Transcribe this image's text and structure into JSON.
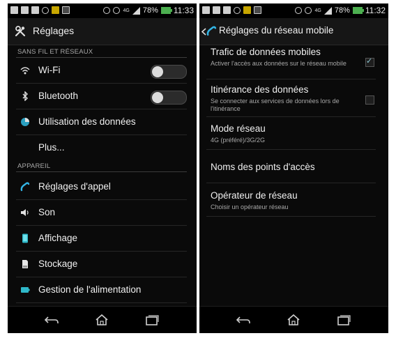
{
  "left": {
    "status": {
      "battery": "78%",
      "time": "11:33",
      "network": "4G"
    },
    "header": {
      "title": "Réglages"
    },
    "sections": {
      "wireless": "SANS FIL ET RÉSEAUX",
      "device": "APPAREIL"
    },
    "items": [
      {
        "label": "Wi-Fi",
        "icon": "wifi-icon",
        "toggle": "off"
      },
      {
        "label": "Bluetooth",
        "icon": "bluetooth-icon",
        "toggle": "off"
      },
      {
        "label": "Utilisation des données",
        "icon": "data-usage-icon"
      },
      {
        "label": "Plus..."
      },
      {
        "label": "Réglages d'appel",
        "icon": "phone-icon"
      },
      {
        "label": "Son",
        "icon": "speaker-icon"
      },
      {
        "label": "Affichage",
        "icon": "display-icon"
      },
      {
        "label": "Stockage",
        "icon": "storage-icon"
      },
      {
        "label": "Gestion de l'alimentation",
        "icon": "battery-icon"
      }
    ]
  },
  "right": {
    "status": {
      "battery": "78%",
      "time": "11:32",
      "network": "4G"
    },
    "header": {
      "title": "Réglages du réseau mobile"
    },
    "items": [
      {
        "title": "Trafic de données mobiles",
        "subtitle": "Activer l'accès aux données sur le réseau mobile",
        "checked": true
      },
      {
        "title": "Itinérance des données",
        "subtitle": "Se connecter aux services de données lors de l'itinérance",
        "checked": false
      },
      {
        "title": "Mode réseau",
        "subtitle": "4G (préféré)/3G/2G"
      },
      {
        "title": "Noms des points d'accès"
      },
      {
        "title": "Opérateur de réseau",
        "subtitle": "Choisir un opérateur réseau"
      }
    ]
  },
  "colors": {
    "background": "#0a0a0a",
    "accent": "#33b5e5",
    "battery": "#4caf50"
  }
}
